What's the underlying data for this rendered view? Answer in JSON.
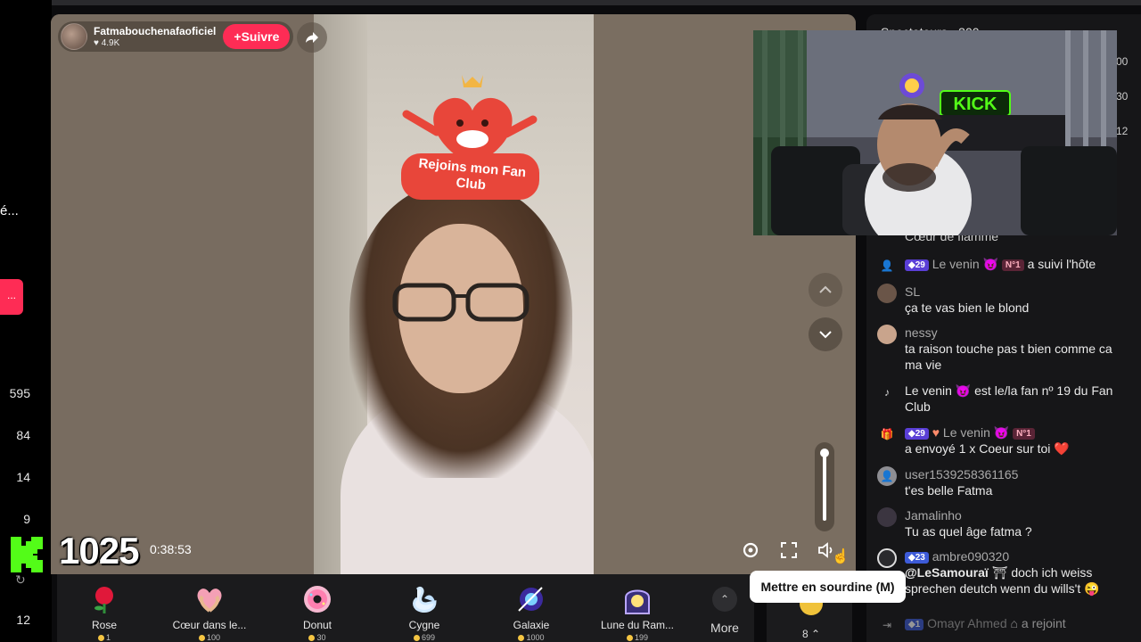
{
  "left_edge": {
    "truncated_text": "é...",
    "pink_button": "...",
    "numbers": [
      "595",
      "84",
      "14",
      "9",
      "12"
    ]
  },
  "host": {
    "name": "Fatmabouchenafaoficiel",
    "likes": "4.9K",
    "follow_label": "Suivre"
  },
  "fan_badge": {
    "text_line1": "Rejoins mon Fan",
    "text_line2": "Club"
  },
  "player": {
    "timer": "0:38:53",
    "tooltip": "Mettre en sourdine (M)"
  },
  "kick_overlay": {
    "viewer_count": "1025"
  },
  "gifts": [
    {
      "name": "Rose",
      "price": "1",
      "icon": "rose-icon"
    },
    {
      "name": "Cœur dans le...",
      "price": "100",
      "icon": "heart-hands-icon"
    },
    {
      "name": "Donut",
      "price": "30",
      "icon": "donut-icon"
    },
    {
      "name": "Cygne",
      "price": "699",
      "icon": "swan-icon"
    },
    {
      "name": "Galaxie",
      "price": "1000",
      "icon": "galaxy-icon"
    },
    {
      "name": "Lune du Ram...",
      "price": "199",
      "icon": "moon-icon"
    }
  ],
  "more_label": "More",
  "coin_count": "8",
  "chat": {
    "header": "Spectateurs · 300",
    "edge_numbers": [
      "00",
      "30",
      "12"
    ],
    "top_fragment": "Cœur de flamme",
    "messages": [
      {
        "type": "system",
        "level": "29",
        "user": "Le venin",
        "rank": "N°1",
        "text": "a suivi l'hôte"
      },
      {
        "type": "chat",
        "user": "SL",
        "text": "ça te vas bien le blond"
      },
      {
        "type": "chat",
        "user": "nessy",
        "text": "ta raison touche pas t bien comme ca ma vie"
      },
      {
        "type": "fanclub",
        "text": "Le venin 😈 est le/la fan nº 19 du Fan Club"
      },
      {
        "type": "gift",
        "level": "29",
        "user": "Le venin",
        "rank": "N°1",
        "text": "a envoyé 1 x Coeur sur toi"
      },
      {
        "type": "chat",
        "user": "user1539258361165",
        "text": "t'es belle Fatma"
      },
      {
        "type": "chat",
        "user": "Jamalinho",
        "text": "Tu as quel âge fatma ?"
      },
      {
        "type": "chat",
        "level": "23",
        "user": "ambre090320",
        "mention": "@LeSamouraï",
        "text": "doch ich weiss sprechen deutch wenn du wills't 😜"
      },
      {
        "type": "join",
        "level": "1",
        "user": "Omayr Ahmed",
        "text": "a rejoint"
      }
    ]
  },
  "colors": {
    "accent": "#fe2c55",
    "kick_green": "#53fc18",
    "panel": "#161618"
  }
}
